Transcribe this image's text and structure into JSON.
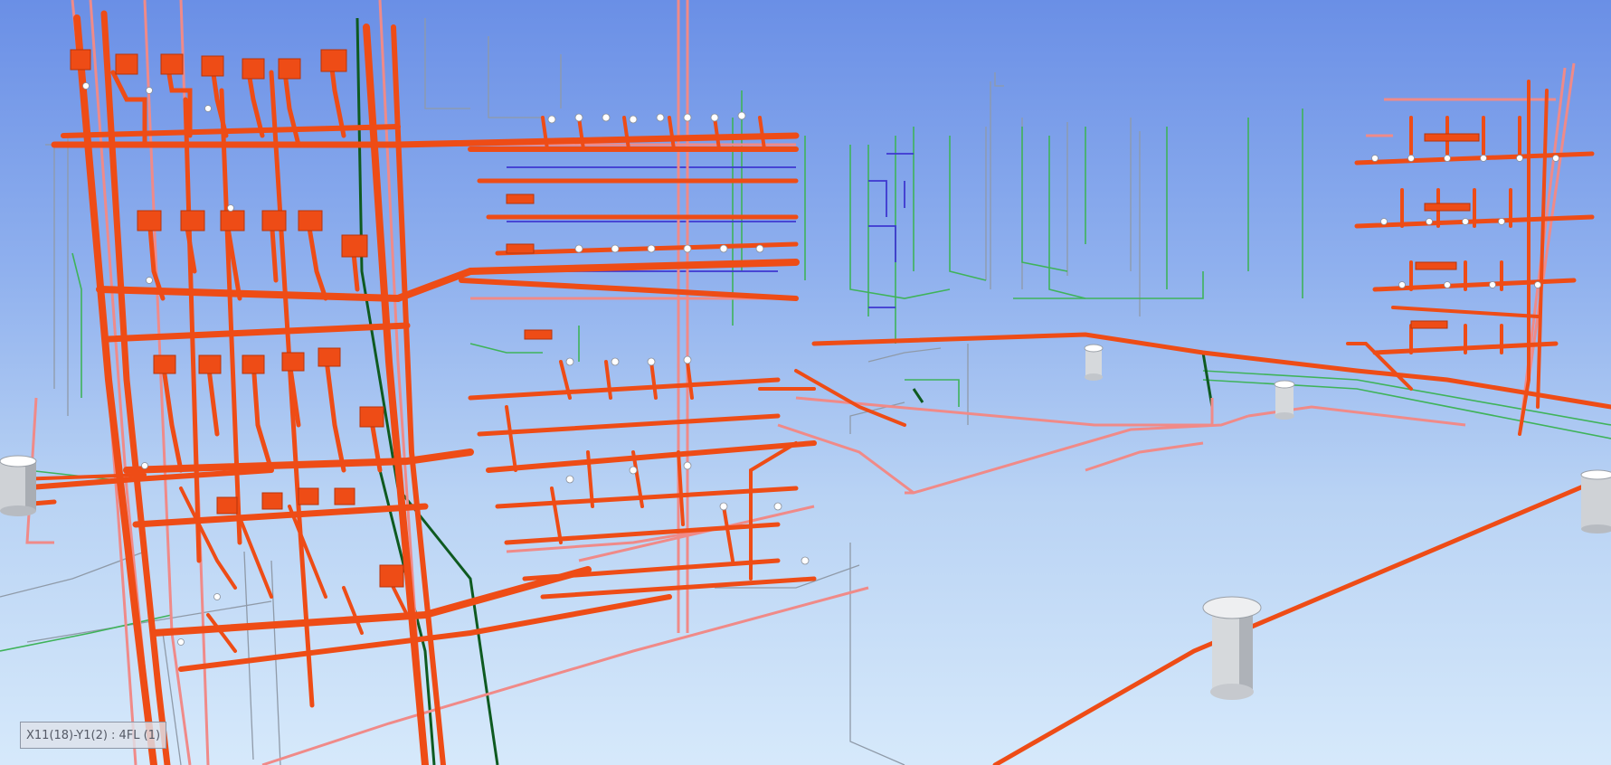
{
  "viewport": {
    "coordinate_label": "X11(18)-Y1(2) : 4FL (1)"
  },
  "colors": {
    "main_pipe": "#ee4c16",
    "pink_pipe": "#f08a88",
    "green_pipe": "#3fb35a",
    "dark_green_pipe": "#0e5a20",
    "blue_pipe": "#3e37d0",
    "gray_line": "#8f9aa8",
    "column": "#d6d9dc"
  }
}
